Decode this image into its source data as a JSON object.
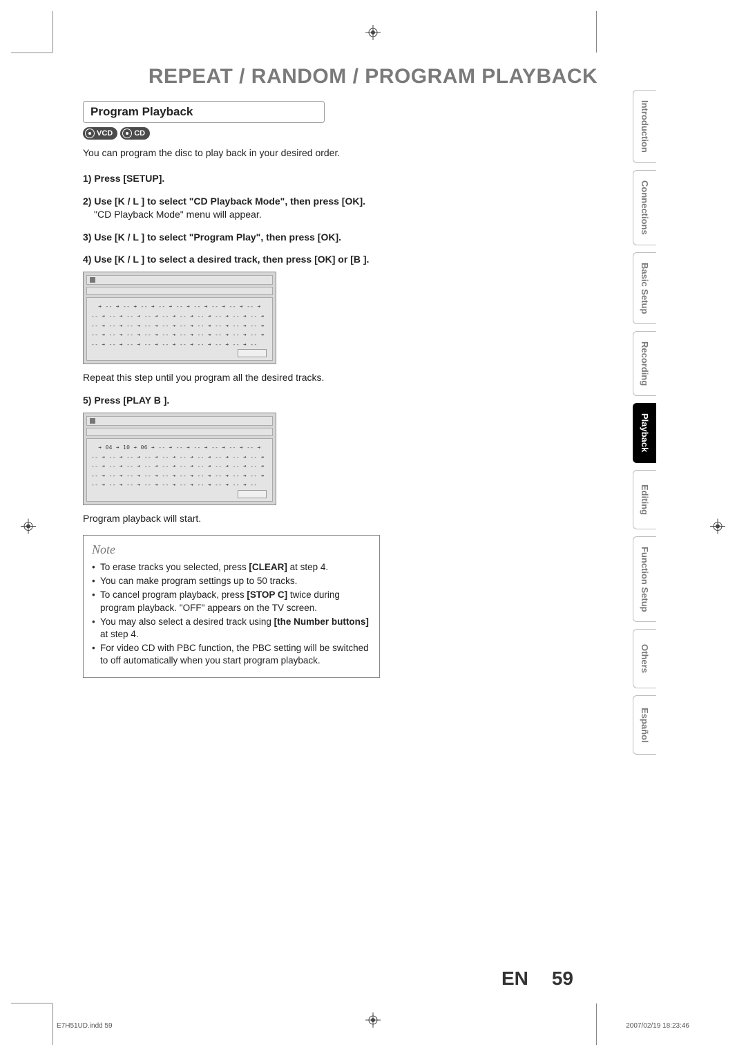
{
  "title": "REPEAT / RANDOM / PROGRAM PLAYBACK",
  "section_header": "Program Playback",
  "badges": {
    "vcd": "VCD",
    "cd": "CD"
  },
  "intro": "You can program the disc to play back in your desired order.",
  "steps": {
    "s1_label": "1) Press [SETUP].",
    "s2_label": "2) Use [K / L ] to select \"CD Playback Mode\", then press [OK].",
    "s2_desc": "\"CD Playback Mode\" menu will appear.",
    "s3_label": "3) Use [K / L ] to select \"Program Play\", then press [OK].",
    "s4_label": "4) Use [K / L ] to select a desired track, then press [OK] or [B ].",
    "s4_desc": "Repeat this step until you program all the desired tracks.",
    "s5_label": "5) Press [PLAY B ].",
    "s5_desc": "Program playback will start."
  },
  "osd": {
    "grid_empty": "  ➔ -- ➔ -- ➔ -- ➔ -- ➔ -- ➔ -- ➔ -- ➔ -- ➔ -- ➔\n-- ➔ -- ➔ -- ➔ -- ➔ -- ➔ -- ➔ -- ➔ -- ➔ -- ➔ -- ➔\n-- ➔ -- ➔ -- ➔ -- ➔ -- ➔ -- ➔ -- ➔ -- ➔ -- ➔ -- ➔\n-- ➔ -- ➔ -- ➔ -- ➔ -- ➔ -- ➔ -- ➔ -- ➔ -- ➔ -- ➔\n-- ➔ -- ➔ -- ➔ -- ➔ -- ➔ -- ➔ -- ➔ -- ➔ -- ➔ --",
    "grid_filled": "  ➔ 04 ➔ 10 ➔ 06 ➔ -- ➔ -- ➔ -- ➔ -- ➔ -- ➔ -- ➔\n-- ➔ -- ➔ -- ➔ -- ➔ -- ➔ -- ➔ -- ➔ -- ➔ -- ➔ -- ➔\n-- ➔ -- ➔ -- ➔ -- ➔ -- ➔ -- ➔ -- ➔ -- ➔ -- ➔ -- ➔\n-- ➔ -- ➔ -- ➔ -- ➔ -- ➔ -- ➔ -- ➔ -- ➔ -- ➔ -- ➔\n-- ➔ -- ➔ -- ➔ -- ➔ -- ➔ -- ➔ -- ➔ -- ➔ -- ➔ --"
  },
  "note": {
    "title": "Note",
    "i1a": "To erase tracks you selected, press ",
    "i1b": "[CLEAR]",
    "i1c": " at step 4.",
    "i2": "You can make program settings up to 50 tracks.",
    "i3a": "To cancel program playback, press ",
    "i3b": "[STOP C]",
    "i3c": " twice during program playback. \"OFF\" appears on the TV screen.",
    "i4a": "You may also select a desired track using ",
    "i4b": "[the Number buttons]",
    "i4c": " at step 4.",
    "i5": "For video CD with PBC function, the PBC setting will be switched to off automatically when you start program playback."
  },
  "tabs": [
    "Introduction",
    "Connections",
    "Basic Setup",
    "Recording",
    "Playback",
    "Editing",
    "Function Setup",
    "Others",
    "Español"
  ],
  "active_tab_index": 4,
  "footer": {
    "lang": "EN",
    "page": "59"
  },
  "print": {
    "left": "E7H51UD.indd   59",
    "right": "2007/02/19   18:23:46"
  }
}
